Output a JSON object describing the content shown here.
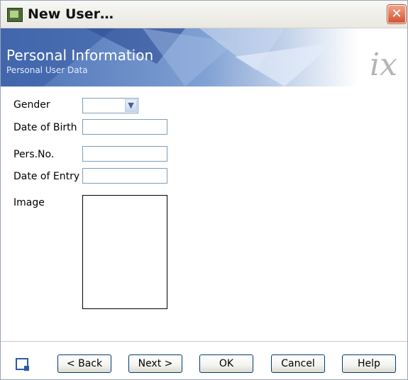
{
  "window": {
    "title": "New User…"
  },
  "banner": {
    "title": "Personal Information",
    "subtitle": "Personal User Data",
    "logo": "ix"
  },
  "form": {
    "gender": {
      "label": "Gender",
      "value": ""
    },
    "date_of_birth": {
      "label": "Date of Birth",
      "value": ""
    },
    "pers_no": {
      "label": "Pers.No.",
      "value": ""
    },
    "date_of_entry": {
      "label": "Date of Entry",
      "value": ""
    },
    "image": {
      "label": "Image"
    }
  },
  "buttons": {
    "back": "< Back",
    "next": "Next >",
    "ok": "OK",
    "cancel": "Cancel",
    "help": "Help"
  },
  "icons": {
    "app": "app-window-icon",
    "close": "close-icon",
    "combo": "chevron-down-icon",
    "help": "help-icon"
  }
}
